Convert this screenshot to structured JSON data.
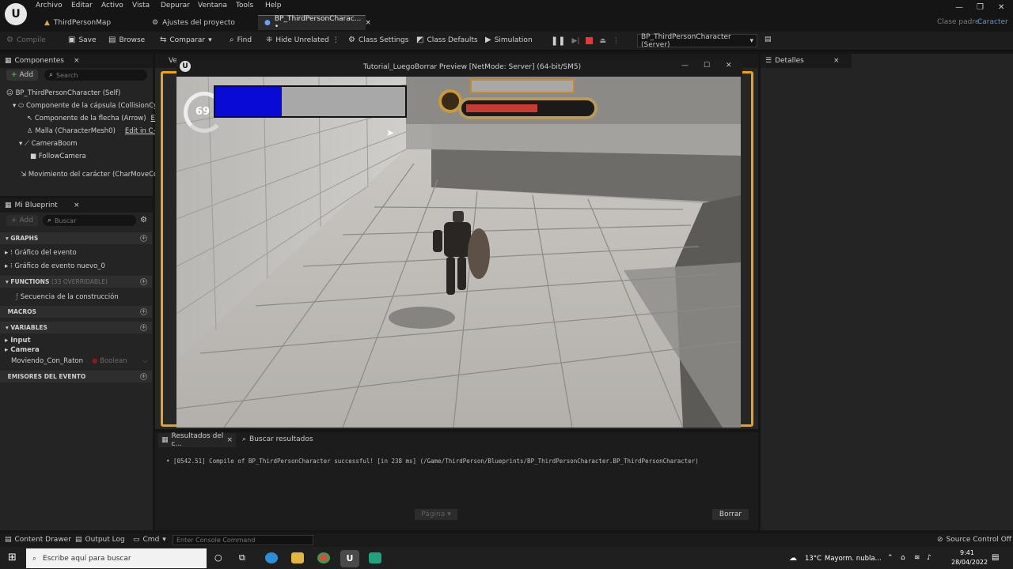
{
  "menu": {
    "items": [
      "Archivo",
      "Editar",
      "Activo",
      "Vista",
      "Depurar",
      "Ventana",
      "Tools",
      "Help"
    ]
  },
  "tabs": [
    {
      "label": "ThirdPersonMap"
    },
    {
      "label": "Ajustes del proyecto"
    },
    {
      "label": "BP_ThirdPersonCharac... •"
    }
  ],
  "window": {
    "parent_class_label": "Clase padre:",
    "parent_class_value": "Caracter"
  },
  "toolbar": {
    "compile": "Compile",
    "save": "Save",
    "browse": "Browse",
    "compare": "Comparar",
    "find": "Find",
    "hide_unrelated": "Hide Unrelated",
    "class_settings": "Class Settings",
    "class_defaults": "Class Defaults",
    "simulation": "Simulation",
    "debug_object": "BP_ThirdPersonCharacter (Server)"
  },
  "components": {
    "title": "Componentes",
    "add": "Add",
    "search_placeholder": "Search",
    "items": [
      "BP_ThirdPersonCharacter (Self)",
      "Componente de la cápsula (CollisionCyli",
      "Componente de la flecha (Arrow)",
      "Malla (CharacterMesh0)",
      "CameraBoom",
      "FollowCamera",
      "Movimiento del carácter (CharMoveCor"
    ],
    "edit_label": "Edit",
    "edit_cpp_label": "Edit in C++"
  },
  "viewport_tab": "Ve",
  "my_blueprint": {
    "title": "Mi Blueprint",
    "add": "Add",
    "search_placeholder": "Buscar",
    "graphs_header": "GRAPHS",
    "graphs": [
      "Gráfico del evento",
      "Gráfico de evento nuevo_0"
    ],
    "functions_header": "FUNCTIONS",
    "functions_count": "(33 OVERRIDABLE)",
    "functions": [
      "Secuencia de la construcción"
    ],
    "macros_header": "MACROS",
    "variables_header": "VARIABLES",
    "variable_groups": [
      "Input",
      "Camera"
    ],
    "variable": {
      "name": "Moviendo_Con_Raton",
      "type": "Boolean"
    },
    "dispatchers_header": "EMISORES DEL EVENTO"
  },
  "preview": {
    "title": "Tutorial_LuegoBorrar Preview [NetMode: Server]  (64-bit/SM5)",
    "hud_number": "69",
    "mana_fill": 0.35,
    "health_fill": 0.58
  },
  "details": {
    "title": "Detalles"
  },
  "results": {
    "tab1": "Resultados del c...",
    "tab2": "Buscar resultados",
    "log": "[0542.51] Compile of BP_ThirdPersonCharacter successful! [in 238 ms] (/Game/ThirdPerson/Blueprints/BP_ThirdPersonCharacter.BP_ThirdPersonCharacter)",
    "page_label": "Página",
    "clear_button": "Borrar"
  },
  "statusbar": {
    "content_drawer": "Content Drawer",
    "output_log": "Output Log",
    "cmd": "Cmd",
    "console_placeholder": "Enter Console Command",
    "source_control": "Source Control Off"
  },
  "taskbar": {
    "search_placeholder": "Escribe aquí para buscar",
    "weather_temp": "13°C",
    "weather_desc": "Mayorm. nubla...",
    "time": "9:41",
    "date": "28/04/2022"
  },
  "colors": {
    "accent": "#3a6fd0",
    "pie_border": "#e8a317",
    "mana": "#0a0ad6",
    "health": "#c83a32"
  }
}
